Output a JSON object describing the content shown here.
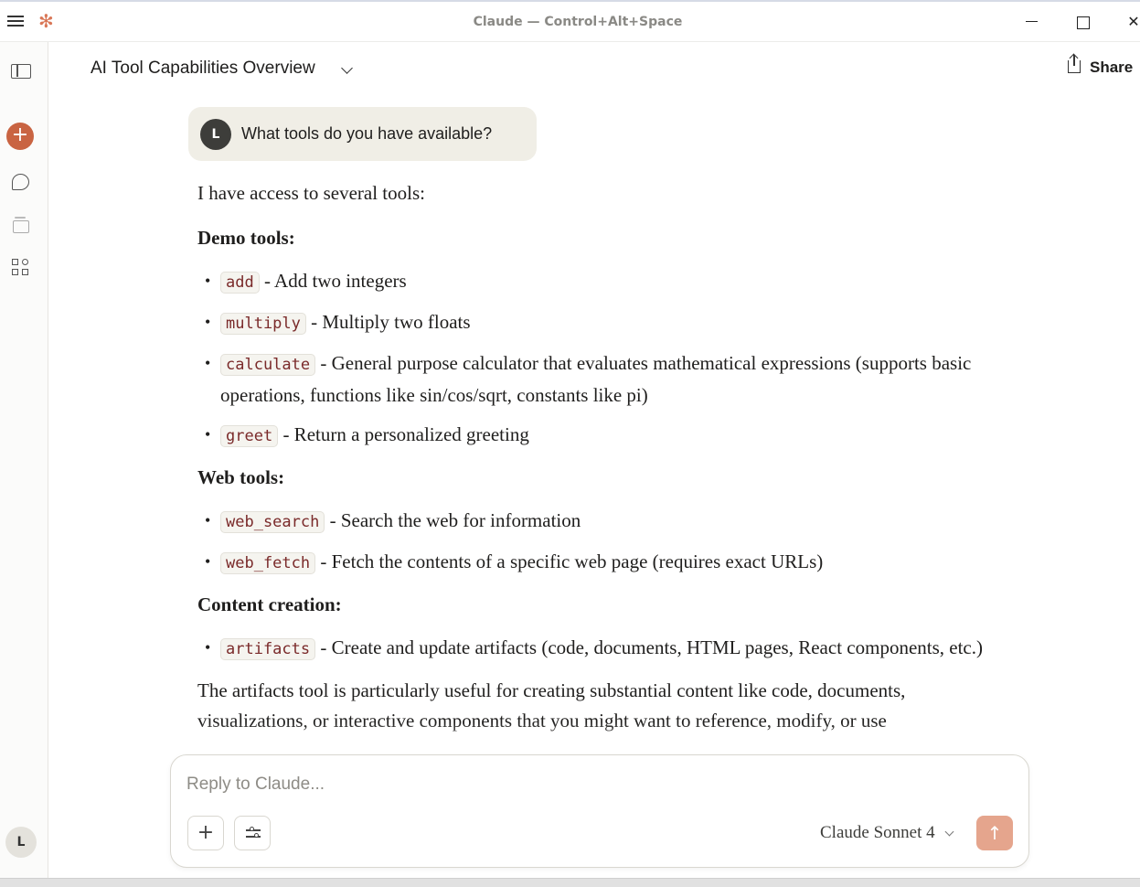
{
  "window": {
    "title": "Claude — Control+Alt+Space",
    "logo_glyph": "✻",
    "close_glyph": "✕"
  },
  "sidebar": {
    "new_chat_glyph": "+",
    "user_initial": "L"
  },
  "header": {
    "conversation_title": "AI Tool Capabilities Overview",
    "share_label": "Share"
  },
  "user_message": {
    "initial": "L",
    "text": "What tools do you have available?"
  },
  "response": {
    "intro": "I have access to several tools:",
    "sections": [
      {
        "heading": "Demo tools:",
        "items": [
          {
            "code": "add",
            "text": " - Add two integers"
          },
          {
            "code": "multiply",
            "text": " - Multiply two floats"
          },
          {
            "code": "calculate",
            "text": " - General purpose calculator that evaluates mathematical expressions (supports basic operations, functions like sin/cos/sqrt, constants like pi)"
          },
          {
            "code": "greet",
            "text": " - Return a personalized greeting"
          }
        ]
      },
      {
        "heading": "Web tools:",
        "items": [
          {
            "code": "web_search",
            "text": " - Search the web for information"
          },
          {
            "code": "web_fetch",
            "text": " - Fetch the contents of a specific web page (requires exact URLs)"
          }
        ]
      },
      {
        "heading": "Content creation:",
        "items": [
          {
            "code": "artifacts",
            "text": " - Create and update artifacts (code, documents, HTML pages, React components, etc.)"
          }
        ]
      }
    ],
    "closing": "The artifacts tool is particularly useful for creating substantial content like code, documents, visualizations, or interactive components that you might want to reference, modify, or use"
  },
  "composer": {
    "placeholder": "Reply to Claude...",
    "value": "",
    "add_glyph": "+",
    "model_label": "Claude Sonnet 4",
    "send_glyph": "↑"
  },
  "colors": {
    "accent": "#c96442",
    "send_button": "#e5a58d",
    "user_bubble": "#f0eee6"
  }
}
